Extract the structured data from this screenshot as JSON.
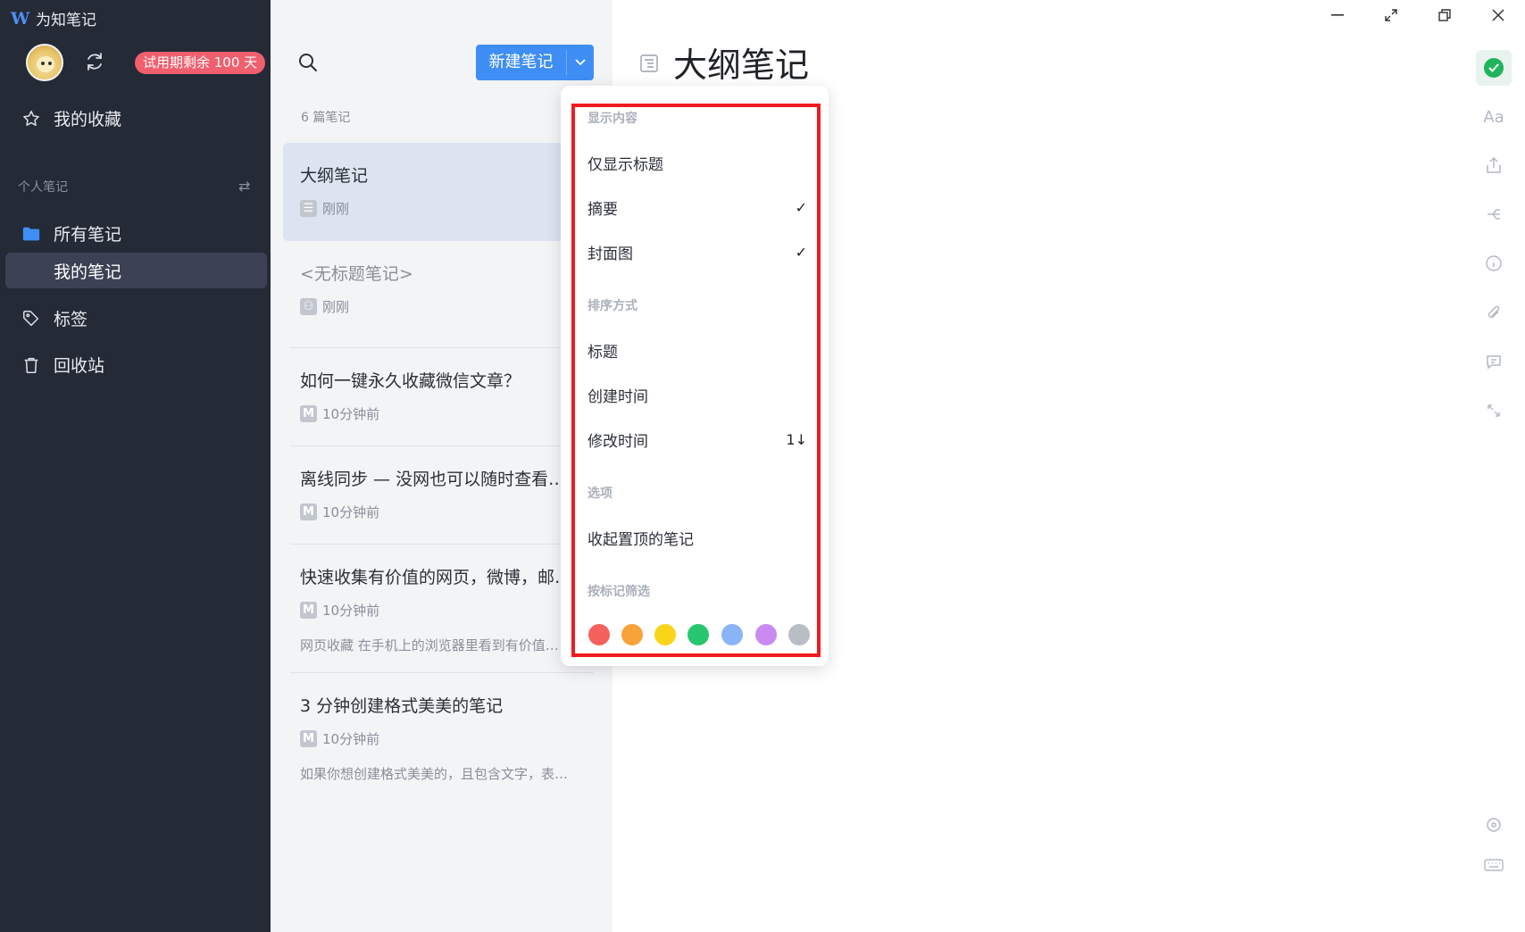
{
  "app": {
    "title": "为知笔记"
  },
  "sidebar": {
    "trial_badge": "试用期剩余 100 天",
    "favorites": "我的收藏",
    "section_label": "个人笔记",
    "all_notes": "所有笔记",
    "my_notes": "我的笔记",
    "tags": "标签",
    "trash": "回收站"
  },
  "notelist": {
    "new_note_label": "新建笔记",
    "count": "6 篇笔记",
    "notes": [
      {
        "title": "大纲笔记",
        "time": "刚刚",
        "excerpt": ""
      },
      {
        "title": "<无标题笔记>",
        "time": "刚刚",
        "excerpt": ""
      },
      {
        "title": "如何一键永久收藏微信文章？",
        "time": "10分钟前",
        "excerpt": ""
      },
      {
        "title": "离线同步 — 没网也可以随时查看…",
        "time": "10分钟前",
        "excerpt": ""
      },
      {
        "title": "快速收集有价值的网页，微博，邮…",
        "time": "10分钟前",
        "excerpt": "网页收藏 在手机上的浏览器里看到有价值…"
      },
      {
        "title": "3 分钟创建格式美美的笔记",
        "time": "10分钟前",
        "excerpt": "如果你想创建格式美美的，且包含文字，表…"
      }
    ]
  },
  "editor": {
    "title": "大纲笔记",
    "font_button": "Aa"
  },
  "dropdown": {
    "display_header": "显示内容",
    "title_only": "仅显示标题",
    "summary": "摘要",
    "cover": "封面图",
    "sort_header": "排序方式",
    "sort_title": "标题",
    "sort_created": "创建时间",
    "sort_modified": "修改时间",
    "options_header": "选项",
    "collapse_pinned": "收起置顶的笔记",
    "filter_header": "按标记筛选",
    "check_mark": "✓",
    "sort_mark": "1↓",
    "swatch_colors": [
      "#f5615d",
      "#f7a33a",
      "#f9d51a",
      "#28c66f",
      "#8ab4f8",
      "#c98bf2",
      "#b9bdc6"
    ]
  }
}
